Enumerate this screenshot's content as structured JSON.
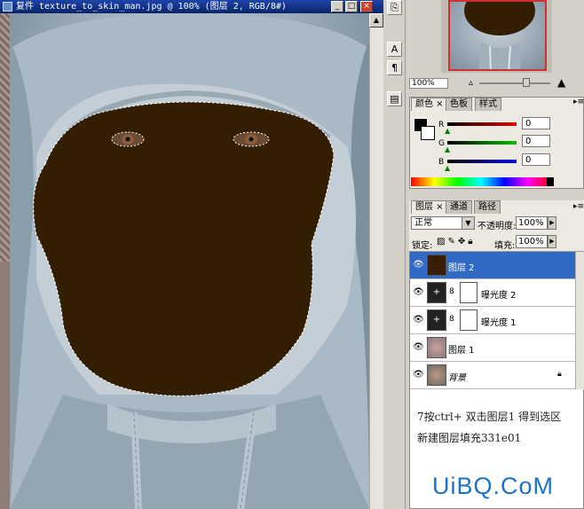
{
  "document": {
    "title": "复件 texture_to_skin_man.jpg @ 100% (图层 2, RGB/8#)",
    "buttons": [
      "_",
      "□",
      "×"
    ]
  },
  "tools": [
    {
      "name": "copy-tool-icon",
      "glyph": "⎘"
    },
    {
      "name": "text-tool-icon",
      "glyph": "A"
    },
    {
      "name": "paragraph-tool-icon",
      "glyph": "¶"
    },
    {
      "name": "palette-tool-icon",
      "glyph": "▤"
    }
  ],
  "navigator": {
    "zoom": "100%"
  },
  "color_panel": {
    "tabs": [
      "颜色 ×",
      "色板",
      "样式"
    ],
    "channels": [
      {
        "label": "R",
        "value": "0",
        "color": "#c00000"
      },
      {
        "label": "G",
        "value": "0",
        "color": "#00a000"
      },
      {
        "label": "B",
        "value": "0",
        "color": "#0000c0"
      }
    ]
  },
  "layers_panel": {
    "tabs": [
      "图层 ×",
      "通道",
      "路径"
    ],
    "blend_mode": "正常",
    "opacity_label": "不透明度:",
    "opacity_value": "100%",
    "lock_label": "锁定:",
    "fill_label": "填充:",
    "fill_value": "100%",
    "layers": [
      {
        "name": "图层 2",
        "selected": true,
        "thumb": "#3a1e04"
      },
      {
        "name": "曝光度 2",
        "selected": false,
        "thumb": "adjust"
      },
      {
        "name": "曝光度 1",
        "selected": false,
        "thumb": "adjust"
      },
      {
        "name": "图层 1",
        "selected": false,
        "thumb": "#8a7a80"
      },
      {
        "name": "背景",
        "selected": false,
        "thumb": "#8c7a6a",
        "locked": true
      }
    ]
  },
  "note": {
    "line1": "7按ctrl+ 双击图层1  得到选区",
    "line2": "新建图层填充331e01"
  },
  "watermark": "UiBQ.CoM",
  "colors": {
    "fill": "#331e01",
    "selection_blue": "#316ac5",
    "title_blue": "#0a246a"
  }
}
